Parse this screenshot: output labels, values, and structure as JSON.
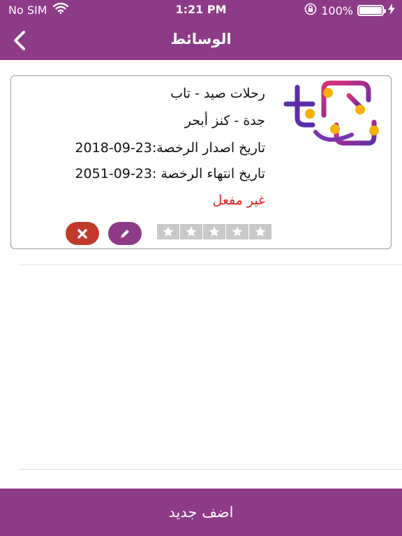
{
  "status_bar": {
    "carrier": "No SIM",
    "time": "1:21 PM",
    "battery": "100%",
    "battery_level": 1.0,
    "icons": [
      "wifi-icon",
      "orientation-lock-icon",
      "battery-icon",
      "charging-bolt-icon"
    ]
  },
  "nav": {
    "title": "الوسائط",
    "back_icon": "chevron-left-icon"
  },
  "card": {
    "name": "رحلات صيد - تاب",
    "location": "جدة - كنز أبحر",
    "license_issue": "تاريخ اصدار الرخصة:23-09-2018",
    "license_expiry": "تاريخ انتهاء الرخصة :23-09-2051",
    "status": "غير مفعل",
    "rating": 0,
    "rating_max": 5,
    "edit_icon": "pencil-icon",
    "delete_icon": "close-icon"
  },
  "footer": {
    "add_label": "اضف جديد"
  },
  "colors": {
    "brand": "#8d3a87",
    "status_inactive": "#e0201f",
    "delete": "#c0392b",
    "star_empty": "#c9c9c9"
  }
}
